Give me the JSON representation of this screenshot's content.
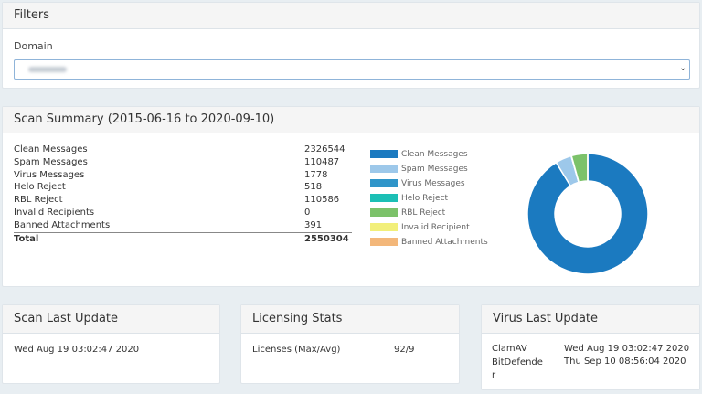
{
  "filters": {
    "title": "Filters",
    "domain_label": "Domain",
    "domain_value": ""
  },
  "summary": {
    "title": "Scan Summary (2015-06-16 to 2020-09-10)",
    "rows": [
      {
        "label": "Clean Messages",
        "value": "2326544"
      },
      {
        "label": "Spam Messages",
        "value": "110487"
      },
      {
        "label": "Virus Messages",
        "value": "1778"
      },
      {
        "label": "Helo Reject",
        "value": "518"
      },
      {
        "label": "RBL Reject",
        "value": "110586"
      },
      {
        "label": "Invalid Recipients",
        "value": "0"
      },
      {
        "label": "Banned Attachments",
        "value": "391"
      }
    ],
    "total": {
      "label": "Total",
      "value": "2550304"
    }
  },
  "chart_data": {
    "type": "pie",
    "variant": "doughnut",
    "legend_position": "left",
    "categories": [
      "Clean Messages",
      "Spam Messages",
      "Virus Messages",
      "Helo Reject",
      "RBL Reject",
      "Invalid Recipient",
      "Banned Attachments"
    ],
    "values": [
      2326544,
      110487,
      1778,
      518,
      110586,
      0,
      391
    ],
    "colors": [
      "#1b7ac0",
      "#9dc8ea",
      "#2f95c9",
      "#1cbfb5",
      "#7cc26a",
      "#f2ef7a",
      "#f3b77a"
    ]
  },
  "scan_update": {
    "title": "Scan Last Update",
    "value": "Wed Aug 19 03:02:47 2020"
  },
  "licensing": {
    "title": "Licensing Stats",
    "label": "Licenses (Max/Avg)",
    "value": "92/9"
  },
  "virus_update": {
    "title": "Virus Last Update",
    "rows": [
      {
        "engine": "ClamAV",
        "date": "Wed Aug 19 03:02:47 2020"
      },
      {
        "engine": "BitDefender",
        "date": "Thu Sep 10 08:56:04 2020"
      }
    ]
  }
}
